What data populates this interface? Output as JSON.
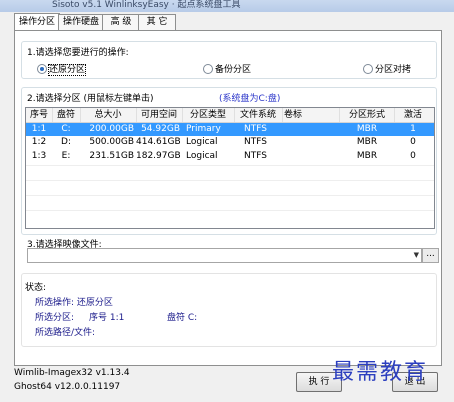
{
  "titlebar": {
    "text": "Sisoto v5.1 WinlinksyEasy · 起点系统盘工具"
  },
  "tabs": [
    "操作分区",
    "操作硬盘",
    "高 级",
    "其 它"
  ],
  "section1": {
    "title": "1.请选择您要进行的操作:",
    "options": [
      {
        "label": "还原分区",
        "selected": true
      },
      {
        "label": "备份分区",
        "selected": false
      },
      {
        "label": "分区对拷",
        "selected": false
      }
    ]
  },
  "section2": {
    "title": "2.请选择分区 (用鼠标左键单击)",
    "system_note": "(系统盘为C:盘)",
    "columns": [
      "序号",
      "盘符",
      "总大小",
      "可用空间",
      "分区类型",
      "文件系统",
      "卷标",
      "分区形式",
      "激活"
    ],
    "rows": [
      [
        "1:1",
        "C:",
        "200.00GB",
        "54.92GB",
        "Primary",
        "NTFS",
        "",
        "MBR",
        "1"
      ],
      [
        "1:2",
        "D:",
        "500.00GB",
        "414.61GB",
        "Logical",
        "NTFS",
        "",
        "MBR",
        "0"
      ],
      [
        "1:3",
        "E:",
        "231.51GB",
        "182.97GB",
        "Logical",
        "NTFS",
        "",
        "MBR",
        "0"
      ]
    ],
    "selected_row": 0
  },
  "section3": {
    "title": "3.请选择映像文件:",
    "value": "",
    "browse_label": "..."
  },
  "status": {
    "title": "状态:",
    "operation_label": "所选操作: 还原分区",
    "partition_label": "所选分区:",
    "number_label": "序号 1:1",
    "drive_label": "盘符 C:",
    "path_label": "所选路径/文件:"
  },
  "footer": {
    "line1": "Wimlib-Imagex32 v1.13.4",
    "line2": "Ghost64 v12.0.0.11197"
  },
  "buttons": {
    "execute": "执 行",
    "exit": "退 出"
  },
  "watermark": "最需教育"
}
